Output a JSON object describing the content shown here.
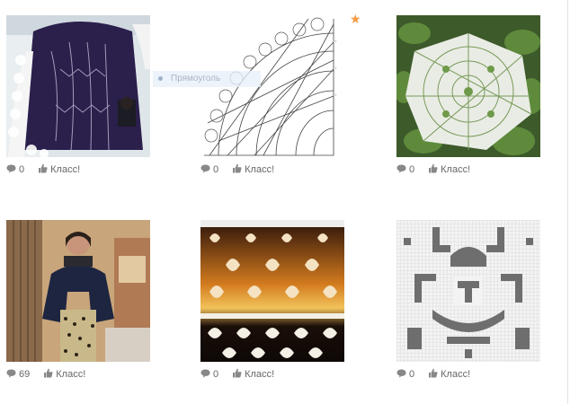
{
  "like_label": "Класс!",
  "overlay_text": "Прямоуголь",
  "accent_color": "#f59a41",
  "cards": [
    {
      "comments": "0",
      "subject": "dark purple crochet skirt with white ruffle"
    },
    {
      "comments": "0",
      "subject": "crochet corner chart diagram"
    },
    {
      "comments": "0",
      "subject": "white lace shawl over plants"
    },
    {
      "comments": "69",
      "subject": "woman in patterned knitted skirt"
    },
    {
      "comments": "0",
      "subject": "orange and black fair-isle pattern"
    },
    {
      "comments": "0",
      "subject": "filet crochet grid chart"
    }
  ]
}
